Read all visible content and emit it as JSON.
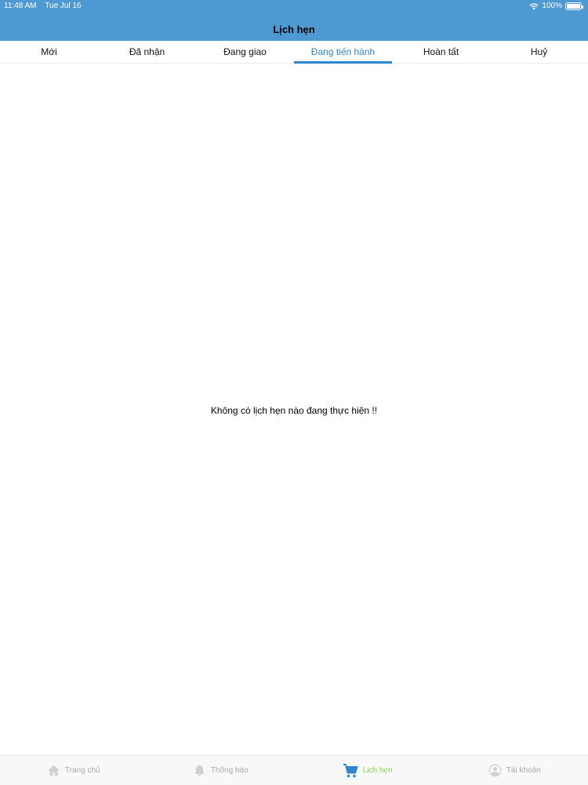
{
  "status_bar": {
    "time": "11:48 AM",
    "date": "Tue Jul 16",
    "battery": "100%"
  },
  "nav": {
    "title": "Lịch hẹn"
  },
  "tabs": [
    {
      "label": "Mới"
    },
    {
      "label": "Đã nhận"
    },
    {
      "label": "Đang giao"
    },
    {
      "label": "Đang tiến hành"
    },
    {
      "label": "Hoàn tất"
    },
    {
      "label": "Huỷ"
    }
  ],
  "active_tab_index": 3,
  "content": {
    "empty_message": "Không có lịch hẹn nào đang thực hiện !!"
  },
  "bottom_tabs": [
    {
      "label": "Trang chủ",
      "icon": "home-icon"
    },
    {
      "label": "Thông báo",
      "icon": "bell-icon"
    },
    {
      "label": "Lịch hẹn",
      "icon": "cart-icon"
    },
    {
      "label": "Tài khoản",
      "icon": "user-icon"
    }
  ],
  "colors": {
    "header_bg": "#4f99d2",
    "active_tab": "#2f86cc",
    "bottom_active": "#8cd154",
    "bottom_inactive": "#aaaaaa"
  }
}
